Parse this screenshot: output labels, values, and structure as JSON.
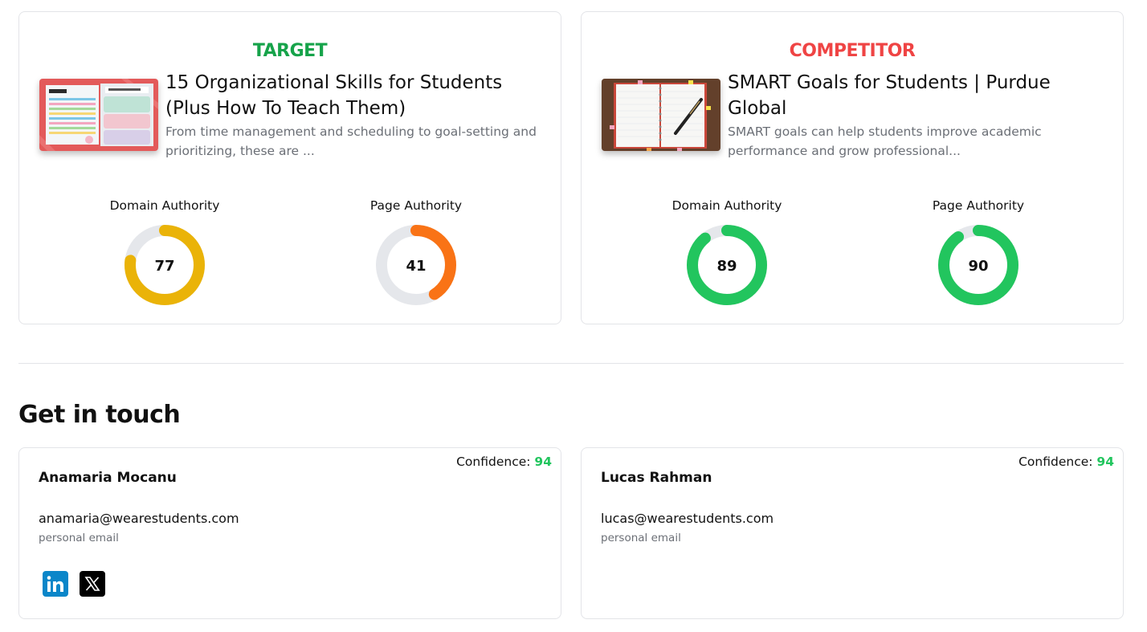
{
  "comparison": [
    {
      "heading": "TARGET",
      "heading_color": "#16a34a",
      "thumbnail_icon": "organizational-skills-worksheets-image",
      "title": "15 Organizational Skills for Students (Plus How To Teach Them)",
      "description": "From time management and scheduling to goal-setting and prioritizing, these are ...",
      "metrics": [
        {
          "label": "Domain Authority",
          "value": "77",
          "color": "#eab308"
        },
        {
          "label": "Page Authority",
          "value": "41",
          "color": "#f97316"
        }
      ]
    },
    {
      "heading": "COMPETITOR",
      "heading_color": "#ef4444",
      "thumbnail_icon": "notebook-and-pen-image",
      "title": "SMART Goals for Students | Purdue Global",
      "description": "SMART goals can help students improve academic performance and grow professional...",
      "metrics": [
        {
          "label": "Domain Authority",
          "value": "89",
          "color": "#22c55e"
        },
        {
          "label": "Page Authority",
          "value": "90",
          "color": "#22c55e"
        }
      ]
    }
  ],
  "gauge_track_color": "#e5e7eb",
  "contacts_section": {
    "title": "Get in touch",
    "confidence_label": "Confidence:",
    "contacts": [
      {
        "name": "Anamaria Mocanu",
        "email": "anamaria@wearestudents.com",
        "email_type": "personal email",
        "confidence": "94",
        "socials": [
          "linkedin-icon",
          "x-twitter-icon"
        ]
      },
      {
        "name": "Lucas Rahman",
        "email": "lucas@wearestudents.com",
        "email_type": "personal email",
        "confidence": "94",
        "socials": []
      }
    ]
  }
}
